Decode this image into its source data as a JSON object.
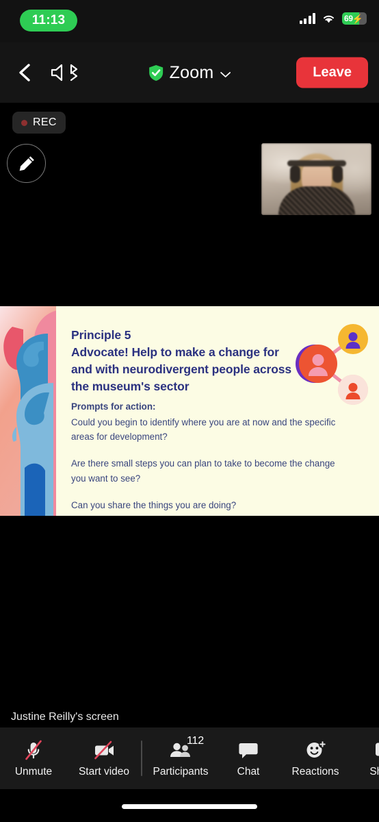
{
  "status_bar": {
    "time": "11:13",
    "time_pill_color": "#2ECC54",
    "battery_percent": "69",
    "battery_charging": true,
    "signal_icon": "cellular-signal-icon",
    "wifi_icon": "wifi-icon",
    "battery_icon": "battery-icon"
  },
  "nav_bar": {
    "back_icon": "back-chevron-icon",
    "audio_icon": "speaker-bluetooth-icon",
    "shield_icon": "shield-check-icon",
    "title": "Zoom",
    "dropdown_icon": "chevron-down-icon",
    "leave_label": "Leave",
    "leave_color": "#E8343A"
  },
  "stage": {
    "recording": {
      "label": "REC",
      "dot_icon": "record-dot-icon",
      "dot_color": "#8E3030"
    },
    "annotate_icon": "pencil-annotate-icon",
    "self_view_name": "self-view-thumbnail",
    "share_label": "Justine Reilly's screen"
  },
  "slide": {
    "background_color": "#FCFCE4",
    "heading_color": "#2B3180",
    "body_color": "#39457E",
    "eyebrow": "Principle 5",
    "title": "Advocate! Help to make a change for and with neurodivergent people across the museum's sector",
    "prompts_heading": "Prompts for action:",
    "prompt_1": "Could you begin to identify where you are at now and the specific areas for development?",
    "prompt_2": "Are there small steps you can plan to take to become the change you want to see?",
    "prompt_3": "Can you share the things you are doing?",
    "artwork_name": "neurodiversity-profiles-illustration",
    "network_graphic_name": "connected-people-network-graphic"
  },
  "toolbar": {
    "items": [
      {
        "label": "Unmute",
        "icon": "microphone-muted-icon",
        "badge": ""
      },
      {
        "label": "Start video",
        "icon": "video-off-icon",
        "badge": ""
      },
      {
        "label": "Participants",
        "icon": "participants-icon",
        "badge": "112"
      },
      {
        "label": "Chat",
        "icon": "chat-bubble-icon",
        "badge": ""
      },
      {
        "label": "Reactions",
        "icon": "reactions-smiley-icon",
        "badge": ""
      },
      {
        "label": "Share",
        "icon": "share-screen-icon",
        "badge": ""
      }
    ]
  }
}
